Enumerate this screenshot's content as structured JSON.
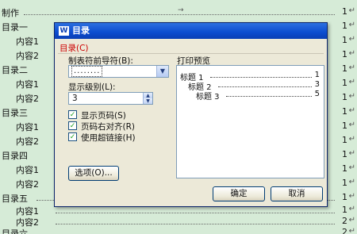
{
  "document": {
    "toc": [
      {
        "text": "制作",
        "page": "1",
        "level": 0
      },
      {
        "text": "目录一",
        "page": "1",
        "level": 0
      },
      {
        "text": "内容1",
        "page": "1",
        "level": 1
      },
      {
        "text": "内容2",
        "page": "1",
        "level": 1
      },
      {
        "text": "目录二",
        "page": "1",
        "level": 0
      },
      {
        "text": "内容1",
        "page": "1",
        "level": 1
      },
      {
        "text": "内容2",
        "page": "1",
        "level": 1
      },
      {
        "text": "目录三",
        "page": "1",
        "level": 0
      },
      {
        "text": "内容1",
        "page": "1",
        "level": 1
      },
      {
        "text": "内容2",
        "page": "1",
        "level": 1
      },
      {
        "text": "目录四",
        "page": "1",
        "level": 0
      },
      {
        "text": "内容1",
        "page": "1",
        "level": 1
      },
      {
        "text": "内容2",
        "page": "1",
        "level": 1
      },
      {
        "text": "目录五",
        "page": "1",
        "level": 0
      },
      {
        "text": "内容1",
        "page": "1",
        "level": 1
      },
      {
        "text": "内容2",
        "page": "2",
        "level": 1
      },
      {
        "text": "目录六",
        "page": "2",
        "level": 0
      }
    ],
    "paragraph_mark": "↵",
    "tab_mark": "→"
  },
  "dialog": {
    "title": "目录",
    "title_icon": "W",
    "tab_label": "目录(C)",
    "leader_label": "制表符前导符(B):",
    "leader_value": "........",
    "level_label": "显示级别(L):",
    "level_value": "3",
    "show_page_numbers": {
      "label": "显示页码(S)",
      "checked": true
    },
    "right_align": {
      "label": "页码右对齐(R)",
      "checked": true
    },
    "use_hyperlinks": {
      "label": "使用超链接(H)",
      "checked": true
    },
    "options_button": "选项(O)...",
    "preview_label": "打印预览",
    "preview": [
      {
        "text": "标题 1",
        "page": "1"
      },
      {
        "text": "标题 2",
        "page": "3"
      },
      {
        "text": "标题 3",
        "page": "5"
      }
    ],
    "ok_button": "确定",
    "cancel_button": "取消"
  },
  "colors": {
    "desktop": "#d6ebd7",
    "titlebar": "#0b4ccf",
    "tab_label": "#cc0000",
    "dialog": "#ece9d8"
  }
}
